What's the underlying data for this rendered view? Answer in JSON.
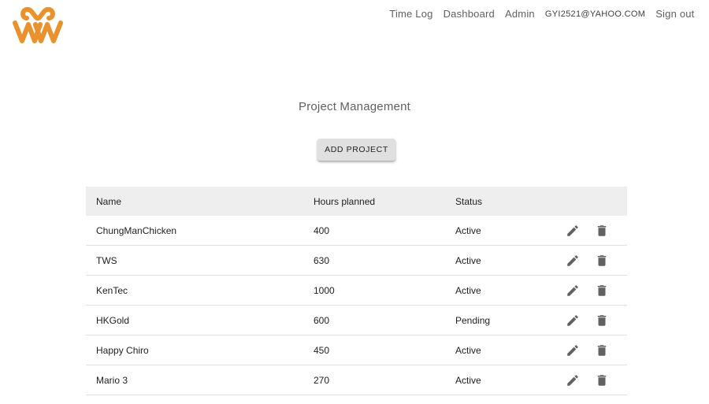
{
  "nav": {
    "items": [
      {
        "label": "Time Log"
      },
      {
        "label": "Dashboard"
      },
      {
        "label": "Admin"
      }
    ],
    "user_email": "GYI2521@YAHOO.COM",
    "sign_out": "Sign out"
  },
  "brand": {
    "logo_icon": "ww-logo",
    "color": "#e8912d"
  },
  "page": {
    "title": "Project Management",
    "add_button": "ADD PROJECT"
  },
  "table": {
    "headers": [
      "Name",
      "Hours planned",
      "Status"
    ],
    "rows": [
      {
        "name": "ChungManChicken",
        "hours": "400",
        "status": "Active"
      },
      {
        "name": "TWS",
        "hours": "630",
        "status": "Active"
      },
      {
        "name": "KenTec",
        "hours": "1000",
        "status": "Active"
      },
      {
        "name": "HKGold",
        "hours": "600",
        "status": "Pending"
      },
      {
        "name": "Happy Chiro",
        "hours": "450",
        "status": "Active"
      },
      {
        "name": "Mario 3",
        "hours": "270",
        "status": "Active"
      }
    ],
    "row_action_icons": [
      "pencil-icon",
      "trash-icon"
    ]
  }
}
